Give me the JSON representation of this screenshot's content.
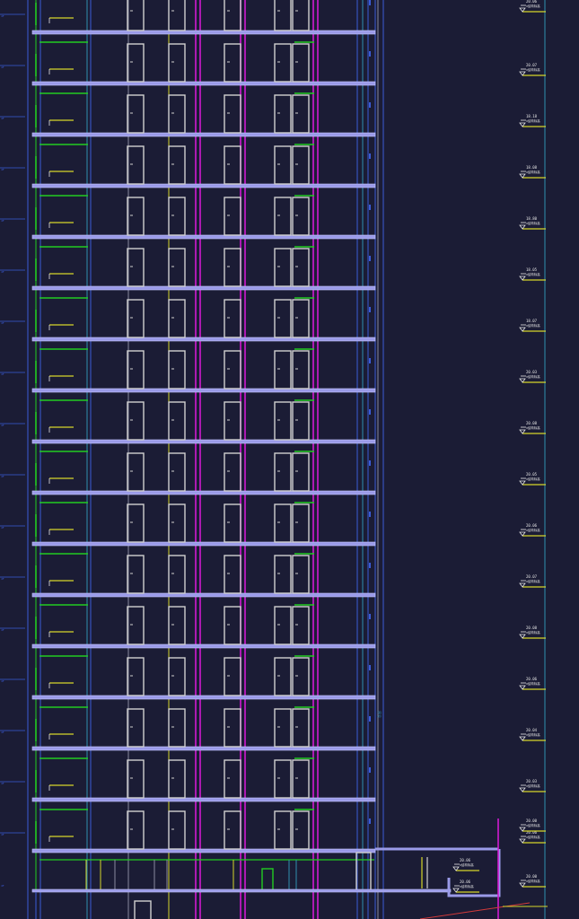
{
  "drawing": {
    "background": "#1b1c35",
    "colors": {
      "slab": "#9a9ae8",
      "slab_edge": "#c8c8ff",
      "column": "#d11ad1",
      "door": "#d0d0d0",
      "green": "#22cc22",
      "yellow": "#d6d62a",
      "blue": "#3b5bd8",
      "cyan": "#2f8fb0",
      "grey": "#8a8aa0",
      "red": "#d23a3a",
      "label": "#e6e6e6"
    }
  },
  "levels": [
    {
      "id": "L20",
      "elevation": "20.06",
      "desc": "±结构标高"
    },
    {
      "id": "L19",
      "elevation": "20.07",
      "desc": "±结构标高"
    },
    {
      "id": "L18",
      "elevation": "18.18",
      "desc": "±结构标高"
    },
    {
      "id": "L17",
      "elevation": "18.08",
      "desc": "±结构标高"
    },
    {
      "id": "L16",
      "elevation": "18.80",
      "desc": "±结构标高"
    },
    {
      "id": "L15",
      "elevation": "18.05",
      "desc": "±结构标高"
    },
    {
      "id": "L14",
      "elevation": "18.07",
      "desc": "±结构标高"
    },
    {
      "id": "L13",
      "elevation": "20.03",
      "desc": "±结构标高"
    },
    {
      "id": "L12",
      "elevation": "20.08",
      "desc": "±结构标高"
    },
    {
      "id": "L11",
      "elevation": "20.05",
      "desc": "±结构标高"
    },
    {
      "id": "L10",
      "elevation": "20.06",
      "desc": "±结构标高"
    },
    {
      "id": "L09",
      "elevation": "20.07",
      "desc": "±结构标高"
    },
    {
      "id": "L08",
      "elevation": "20.08",
      "desc": "±结构标高"
    },
    {
      "id": "L07",
      "elevation": "20.06",
      "desc": "±结构标高"
    },
    {
      "id": "L06",
      "elevation": "20.04",
      "desc": "±结构标高"
    },
    {
      "id": "L05",
      "elevation": "20.03",
      "desc": "±结构标高"
    },
    {
      "id": "L04",
      "elevation": "20.06",
      "desc": "±结构标高"
    }
  ],
  "podium": {
    "labels": [
      {
        "id": "p1",
        "elevation": "20.00",
        "desc": "±结构标高"
      },
      {
        "id": "p2",
        "elevation": "20.00",
        "desc": "±结构标高"
      },
      {
        "id": "p3",
        "elevation": "20.06",
        "desc": "±结构标高"
      },
      {
        "id": "p4",
        "elevation": "20.06",
        "desc": "±结构标高"
      }
    ]
  },
  "side_marks": "4F",
  "vertical_tags": [
    "序号"
  ]
}
